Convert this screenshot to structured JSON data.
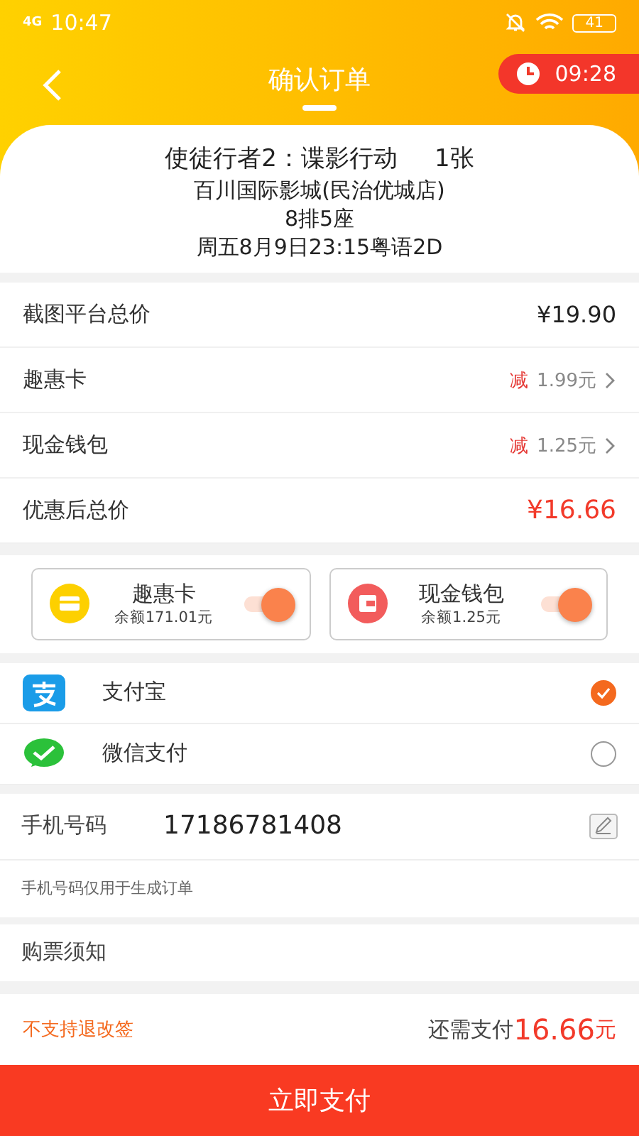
{
  "status_bar": {
    "network": "4G",
    "time": "10:47",
    "battery": "41"
  },
  "header": {
    "title": "确认订单",
    "timer": "09:28"
  },
  "ticket": {
    "movie": "使徒行者2：谍影行动",
    "count": "1张",
    "cinema": "百川国际影城(民治优城店)",
    "seat": "8排5座",
    "showtime": "周五8月9日23:15粤语2D"
  },
  "price_rows": [
    {
      "kind": "plain",
      "label": "截图平台总价",
      "value": "¥19.90"
    },
    {
      "kind": "discount",
      "label": "趣惠卡",
      "prefix": "减",
      "value": "1.99元"
    },
    {
      "kind": "discount",
      "label": "现金钱包",
      "prefix": "减",
      "value": "1.25元"
    },
    {
      "kind": "total",
      "label": "优惠后总价",
      "value": "¥16.66"
    }
  ],
  "balance_cards": [
    {
      "kind": "card",
      "name": "趣惠卡",
      "balance": "余额171.01元",
      "on": true
    },
    {
      "kind": "wallet",
      "name": "现金钱包",
      "balance": "余额1.25元",
      "on": true
    }
  ],
  "payment_methods": [
    {
      "kind": "alipay",
      "name": "支付宝",
      "selected": true
    },
    {
      "kind": "wechat",
      "name": "微信支付",
      "selected": false
    }
  ],
  "phone": {
    "label": "手机号码",
    "value": "17186781408",
    "note": "手机号码仅用于生成订单"
  },
  "notice": {
    "label": "购票须知"
  },
  "footer": {
    "policy": "不支持退改签",
    "due_label": "还需支付",
    "due_amount": "16.66",
    "due_unit": "元",
    "pay_button": "立即支付"
  }
}
